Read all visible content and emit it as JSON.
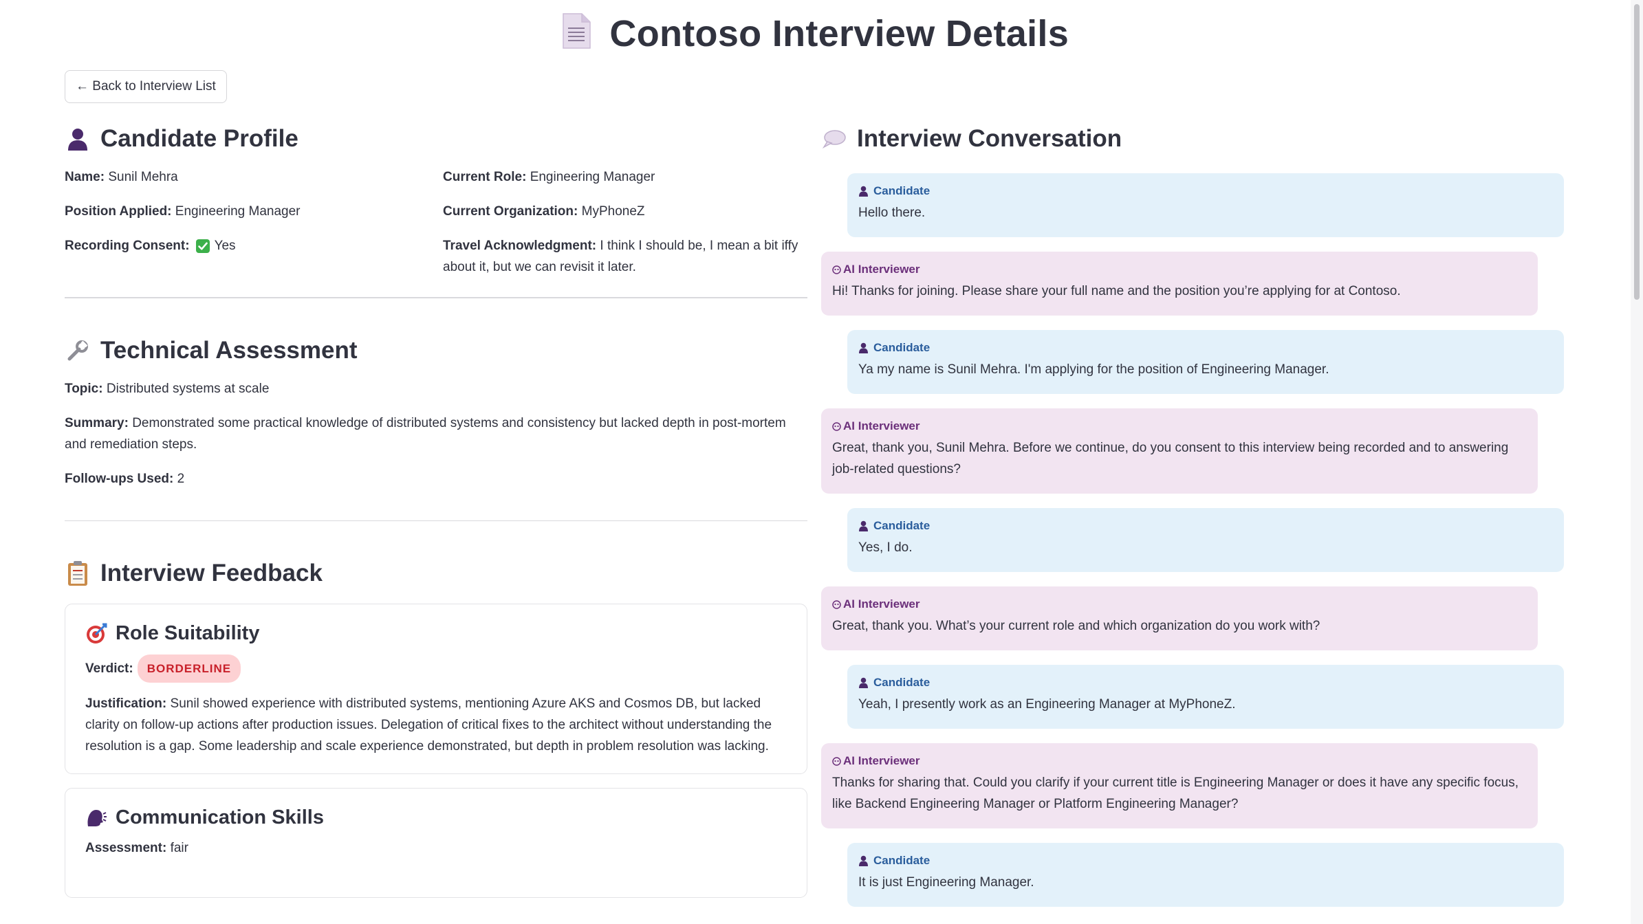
{
  "header": {
    "title": "Contoso Interview Details",
    "icon": "document-icon"
  },
  "nav": {
    "back_label": "← Back to Interview List"
  },
  "candidate_profile": {
    "heading": "Candidate Profile",
    "name_label": "Name:",
    "name_value": "Sunil Mehra",
    "position_label": "Position Applied:",
    "position_value": "Engineering Manager",
    "consent_label": "Recording Consent:",
    "consent_value": "Yes",
    "current_role_label": "Current Role:",
    "current_role_value": "Engineering Manager",
    "current_org_label": "Current Organization:",
    "current_org_value": "MyPhoneZ",
    "travel_label": "Travel Acknowledgment:",
    "travel_value": "I think I should be, I mean a bit iffy about it, but we can revisit it later."
  },
  "technical_assessment": {
    "heading": "Technical Assessment",
    "topic_label": "Topic:",
    "topic_value": "Distributed systems at scale",
    "summary_label": "Summary:",
    "summary_value": "Demonstrated some practical knowledge of distributed systems and consistency but lacked depth in post-mortem and remediation steps.",
    "followups_label": "Follow-ups Used:",
    "followups_value": "2"
  },
  "interview_feedback": {
    "heading": "Interview Feedback",
    "role_suitability": {
      "heading": "Role Suitability",
      "verdict_label": "Verdict:",
      "verdict_value": "BORDERLINE",
      "verdict_color": "#c8202a",
      "justification_label": "Justification:",
      "justification_value": "Sunil showed experience with distributed systems, mentioning Azure AKS and Cosmos DB, but lacked clarity on follow-up actions after production issues. Delegation of critical fixes to the architect without understanding the resolution is a gap. Some leadership and scale experience demonstrated, but depth in problem resolution was lacking."
    },
    "communication": {
      "heading": "Communication Skills",
      "assessment_label": "Assessment:",
      "assessment_value": "fair"
    }
  },
  "conversation": {
    "heading": "Interview Conversation",
    "messages": [
      {
        "speaker": "Candidate",
        "text": "Hello there."
      },
      {
        "speaker": "AI Interviewer",
        "text": "Hi! Thanks for joining. Please share your full name and the position you’re applying for at Contoso."
      },
      {
        "speaker": "Candidate",
        "text": "Ya my name is Sunil Mehra. I'm applying for the position of Engineering Manager."
      },
      {
        "speaker": "AI Interviewer",
        "text": "Great, thank you, Sunil Mehra. Before we continue, do you consent to this interview being recorded and to answering job-related questions?"
      },
      {
        "speaker": "Candidate",
        "text": "Yes, I do."
      },
      {
        "speaker": "AI Interviewer",
        "text": "Great, thank you. What’s your current role and which organization do you work with?"
      },
      {
        "speaker": "Candidate",
        "text": "Yeah, I presently work as an Engineering Manager at MyPhoneZ."
      },
      {
        "speaker": "AI Interviewer",
        "text": "Thanks for sharing that. Could you clarify if your current title is Engineering Manager or does it have any specific focus, like Backend Engineering Manager or Platform Engineering Manager?"
      },
      {
        "speaker": "Candidate",
        "text": "It is just Engineering Manager."
      }
    ]
  },
  "colors": {
    "candidate_bubble": "#e3f1fa",
    "ai_bubble": "#f2e4f1",
    "candidate_label": "#2a5d9c",
    "ai_label": "#6b2f7a"
  }
}
